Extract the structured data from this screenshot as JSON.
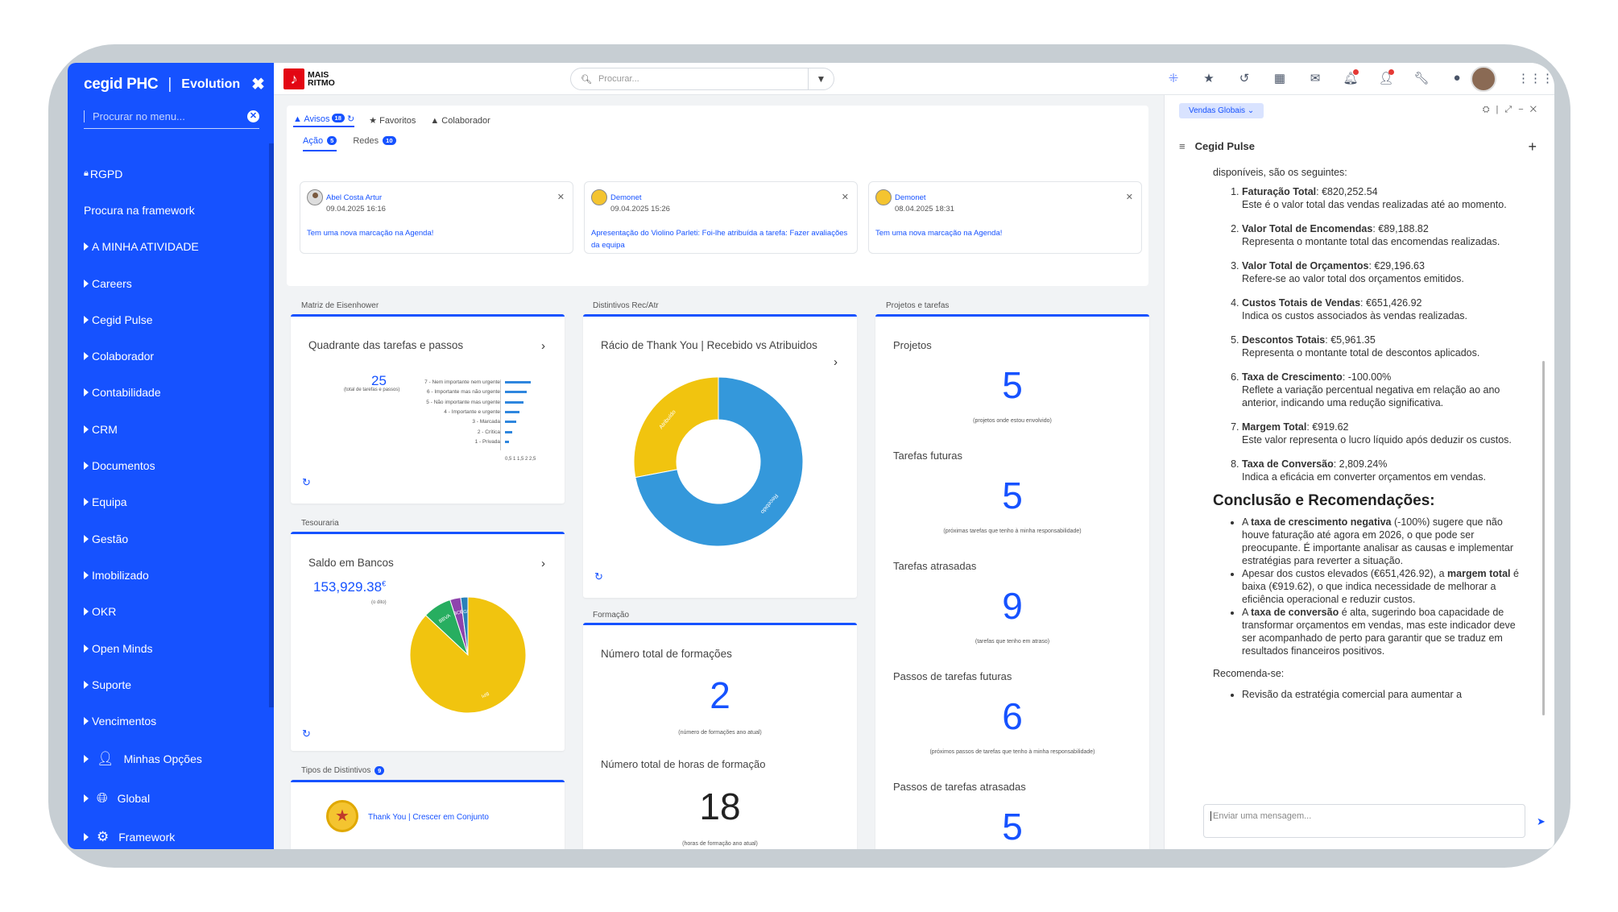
{
  "sidebar": {
    "brand": "cegid PHC",
    "edition": "Evolution",
    "close": "✖",
    "search_placeholder": "Procurar no menu...",
    "items": [
      {
        "label": "RGPD",
        "type": "lock"
      },
      {
        "label": "Procura na framework",
        "type": "plain"
      },
      {
        "label": "A MINHA ATIVIDADE",
        "type": "arrow"
      },
      {
        "label": "Careers",
        "type": "arrow"
      },
      {
        "label": "Cegid Pulse",
        "type": "arrow"
      },
      {
        "label": "Colaborador",
        "type": "arrow"
      },
      {
        "label": "Contabilidade",
        "type": "arrow"
      },
      {
        "label": "CRM",
        "type": "arrow"
      },
      {
        "label": "Documentos",
        "type": "arrow"
      },
      {
        "label": "Equipa",
        "type": "arrow"
      },
      {
        "label": "Gestão",
        "type": "arrow"
      },
      {
        "label": "Imobilizado",
        "type": "arrow"
      },
      {
        "label": "OKR",
        "type": "arrow"
      },
      {
        "label": "Open Minds",
        "type": "arrow"
      },
      {
        "label": "Suporte",
        "type": "arrow"
      },
      {
        "label": "Vencimentos",
        "type": "arrow"
      },
      {
        "label": "Minhas Opções",
        "type": "user"
      },
      {
        "label": "Global",
        "type": "globe"
      },
      {
        "label": "Framework",
        "type": "gears"
      }
    ]
  },
  "topbar": {
    "logo_top": "MAIS",
    "logo_bottom": "RITMO",
    "search_placeholder": "Procurar..."
  },
  "avisos": {
    "tabs": [
      {
        "label": "Avisos",
        "badge": "18"
      },
      {
        "label": "Favoritos"
      },
      {
        "label": "Colaborador"
      }
    ],
    "subtabs": [
      {
        "label": "Ação",
        "badge": "5"
      },
      {
        "label": "Redes",
        "badge": "10"
      }
    ],
    "cards": [
      {
        "name": "Abel Costa Artur",
        "date": "09.04.2025 16:16",
        "text": "Tem uma nova marcação na Agenda!"
      },
      {
        "name": "Demonet",
        "date": "09.04.2025 15:26",
        "text": "Apresentação do Violino Parleti: Foi-lhe atribuída a tarefa: Fazer avaliações da equipa"
      },
      {
        "name": "Demonet",
        "date": "08.04.2025 18:31",
        "text": "Tem uma nova marcação na Agenda!"
      }
    ]
  },
  "eisenhower": {
    "section": "Matriz de Eisenhower",
    "title": "Quadrante das tarefas e passos",
    "total": "25",
    "total_label": "(total de tarefas e passos)",
    "rows": [
      {
        "label": "7 - Nem importante nem urgente",
        "value": 7
      },
      {
        "label": "6 - Importante mas não urgente",
        "value": 6
      },
      {
        "label": "5 - Não importante mas urgente",
        "value": 5
      },
      {
        "label": "4 - Importante e urgente",
        "value": 4
      },
      {
        "label": "3 - Marcada",
        "value": 3
      },
      {
        "label": "2 - Crítica",
        "value": 2
      },
      {
        "label": "1 - Privada",
        "value": 1
      }
    ],
    "xlabel": "0,5 1 1,5 2 2,5"
  },
  "tesouraria": {
    "section": "Tesouraria",
    "title": "Saldo em Bancos",
    "value": "153,929.38",
    "currency": "€",
    "note": "(o dito)",
    "slices": [
      {
        "label": "BBVA",
        "value": 0.08,
        "color": "#27ae60"
      },
      {
        "label": "BCP",
        "value": 0.03,
        "color": "#8e44ad"
      },
      {
        "label": "CGD",
        "value": 0.02,
        "color": "#2980b9"
      },
      {
        "label": "BPI",
        "value": 0.87,
        "color": "#f1c40f"
      }
    ]
  },
  "distintivos": {
    "section": "Distintivos Rec/Atr",
    "title": "Rácio de Thank You | Recebido vs Atribuidos",
    "chart_data": {
      "type": "pie",
      "categories": [
        "Atribuído",
        "Recebido"
      ],
      "values": [
        28,
        72
      ],
      "colors": [
        "#f1c40f",
        "#3498db"
      ]
    }
  },
  "tipos": {
    "section": "Tipos de Distintivos",
    "badge": "9",
    "item": "Thank You | Crescer em Conjunto"
  },
  "formacao": {
    "section": "Formação",
    "t1": "Número total de formações",
    "v1": "2",
    "n1": "(número de formações ano atual)",
    "t2": "Número total de horas de formação",
    "v2": "18",
    "n2": "(horas de formação ano atual)"
  },
  "projetos": {
    "section": "Projetos e tarefas",
    "items": [
      {
        "title": "Projetos",
        "value": "5",
        "note": "(projetos onde estou envolvido)"
      },
      {
        "title": "Tarefas futuras",
        "value": "5",
        "note": "(próximas tarefas que tenho à minha responsabilidade)"
      },
      {
        "title": "Tarefas atrasadas",
        "value": "9",
        "note": "(tarefas que tenho em atraso)"
      },
      {
        "title": "Passos de tarefas futuras",
        "value": "6",
        "note": "(próximos passos de tarefas que tenho à minha responsabilidade)"
      },
      {
        "title": "Passos de tarefas atrasadas",
        "value": "5",
        "note": ""
      }
    ]
  },
  "pulse": {
    "dropdown": "Vendas Globais",
    "title": "Cegid Pulse",
    "intro": "disponíveis, são os seguintes:",
    "metrics": [
      {
        "name": "Faturação Total",
        "value": ": €820,252.54",
        "desc": "Este é o valor total das vendas realizadas até ao momento."
      },
      {
        "name": "Valor Total de Encomendas",
        "value": ": €89,188.82",
        "desc": "Representa o montante total das encomendas realizadas."
      },
      {
        "name": "Valor Total de Orçamentos",
        "value": ": €29,196.63",
        "desc": "Refere-se ao valor total dos orçamentos emitidos."
      },
      {
        "name": "Custos Totais de Vendas",
        "value": ": €651,426.92",
        "desc": "Indica os custos associados às vendas realizadas."
      },
      {
        "name": "Descontos Totais",
        "value": ": €5,961.35",
        "desc": "Representa o montante total de descontos aplicados."
      },
      {
        "name": "Taxa de Crescimento",
        "value": ": -100.00%",
        "desc": "Reflete a variação percentual negativa em relação ao ano anterior, indicando uma redução significativa."
      },
      {
        "name": "Margem Total",
        "value": ": €919.62",
        "desc": "Este valor representa o lucro líquido após deduzir os custos."
      },
      {
        "name": "Taxa de Conversão",
        "value": ": 2,809.24%",
        "desc": "Indica a eficácia em converter orçamentos em vendas."
      }
    ],
    "conclusion_title": "Conclusão e Recomendações:",
    "bullets": [
      "A <b>taxa de crescimento negativa</b> (-100%) sugere que não houve faturação até agora em 2026, o que pode ser preocupante. É importante analisar as causas e implementar estratégias para reverter a situação.",
      "Apesar dos custos elevados (€651,426.92), a <b>margem total</b> é baixa (€919.62), o que indica necessidade de melhorar a eficiência operacional e reduzir custos.",
      "A <b>taxa de conversão</b> é alta, sugerindo boa capacidade de transformar orçamentos em vendas, mas este indicador deve ser acompanhado de perto para garantir que se traduz em resultados financeiros positivos."
    ],
    "recommend": "Recomenda-se:",
    "rec_items": [
      "Revisão da estratégia comercial para aumentar a"
    ],
    "input_placeholder": "Enviar uma mensagem..."
  }
}
